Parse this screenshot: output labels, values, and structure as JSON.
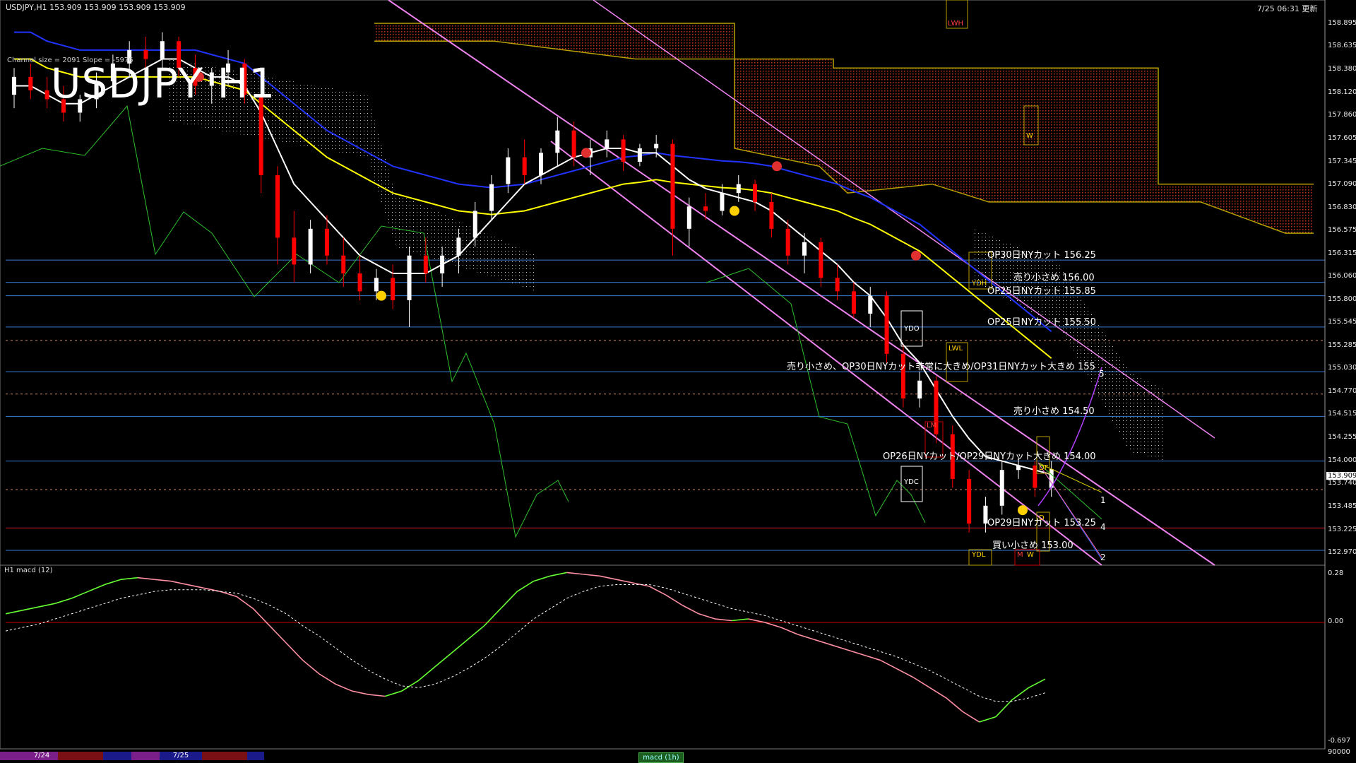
{
  "header": {
    "instrument_info": "USDJPY,H1  153.909 153.909 153.909 153.909",
    "timestamp": "7/25 06:31 更新"
  },
  "title": "USDJPY H1",
  "channel_info": "Channel size = 2091  Slope = -5976",
  "subwindow_title": "H1  macd (12)",
  "current_price": "153.909",
  "colors": {
    "background": "#000000",
    "bull_candle": "#ffffff",
    "bear_candle": "#ff0000",
    "channel": "#ee82ee",
    "ma_white": "#ffffff",
    "ma_yellow": "#ffff00",
    "ma_blue": "#2233ff",
    "cloud_red": "#c0361a",
    "level_line": "#3a7bd5",
    "macd_up": "#66ff33",
    "macd_down": "#ff8fa3",
    "macd_signal": "#ffffff"
  },
  "price_axis": [
    "158.895",
    "158.635",
    "158.380",
    "158.120",
    "157.860",
    "157.605",
    "157.345",
    "157.090",
    "156.830",
    "156.575",
    "156.315",
    "156.060",
    "155.800",
    "155.545",
    "155.285",
    "155.030",
    "154.770",
    "154.515",
    "154.255",
    "154.000",
    "153.740",
    "153.485",
    "153.225",
    "152.970"
  ],
  "macd_axis": [
    "0.28",
    "0.00",
    "-0.697",
    "90000"
  ],
  "level_labels": [
    {
      "text": "OP30日NYカット 156.25",
      "price": 156.25
    },
    {
      "text": "売り小さめ 156.00",
      "price": 156.0
    },
    {
      "text": "OP25日NYカット 155.85",
      "price": 155.85
    },
    {
      "text": "OP25日NYカット 155.50",
      "price": 155.5
    },
    {
      "text": "売り小さめ、OP30日NYカット非常に大きめ/OP31日NYカット大きめ 155",
      "price": 155.0
    },
    {
      "text": "売り小さめ 154.50",
      "price": 154.5
    },
    {
      "text": "OP26日NYカット/OP29日NYカット大きめ 154.00",
      "price": 154.0
    },
    {
      "text": "OP29日NYカット 153.25",
      "price": 153.25
    },
    {
      "text": "買い小さめ 153.00",
      "price": 153.0
    }
  ],
  "box_labels": {
    "lwh": "LWH",
    "w": "W",
    "ydh": "YDH",
    "ydo": "YDO",
    "lwl": "LWL",
    "lm": "LM",
    "ydc": "YDC",
    "df": "DF",
    "d": "D",
    "ydl": "YDL",
    "m": "M",
    "w2": "W"
  },
  "fan_labels": [
    "1",
    "4",
    "2",
    "5"
  ],
  "bottom_dates": [
    "7/24",
    "7/25"
  ],
  "bottom_tab": "macd (1h)",
  "chart_data": {
    "type": "candlestick",
    "title": "USDJPY H1",
    "y_range": [
      152.85,
      159.05
    ],
    "candles": [
      {
        "o": 158.1,
        "h": 158.4,
        "l": 157.95,
        "c": 158.3
      },
      {
        "o": 158.3,
        "h": 158.45,
        "l": 158.05,
        "c": 158.15
      },
      {
        "o": 158.15,
        "h": 158.3,
        "l": 157.95,
        "c": 158.05
      },
      {
        "o": 158.05,
        "h": 158.2,
        "l": 157.8,
        "c": 157.9
      },
      {
        "o": 157.9,
        "h": 158.1,
        "l": 157.8,
        "c": 158.05
      },
      {
        "o": 158.05,
        "h": 158.35,
        "l": 157.95,
        "c": 158.25
      },
      {
        "o": 158.25,
        "h": 158.55,
        "l": 158.15,
        "c": 158.45
      },
      {
        "o": 158.45,
        "h": 158.7,
        "l": 158.3,
        "c": 158.6
      },
      {
        "o": 158.6,
        "h": 158.75,
        "l": 158.4,
        "c": 158.5
      },
      {
        "o": 158.5,
        "h": 158.8,
        "l": 158.4,
        "c": 158.7
      },
      {
        "o": 158.7,
        "h": 158.75,
        "l": 158.3,
        "c": 158.4
      },
      {
        "o": 158.4,
        "h": 158.55,
        "l": 158.1,
        "c": 158.2
      },
      {
        "o": 158.2,
        "h": 158.4,
        "l": 158.0,
        "c": 158.35
      },
      {
        "o": 158.35,
        "h": 158.6,
        "l": 158.2,
        "c": 158.45
      },
      {
        "o": 158.45,
        "h": 158.5,
        "l": 158.0,
        "c": 158.1
      },
      {
        "o": 158.1,
        "h": 158.15,
        "l": 157.0,
        "c": 157.2
      },
      {
        "o": 157.2,
        "h": 157.3,
        "l": 156.2,
        "c": 156.5
      },
      {
        "o": 156.5,
        "h": 156.8,
        "l": 156.0,
        "c": 156.2
      },
      {
        "o": 156.2,
        "h": 156.7,
        "l": 156.1,
        "c": 156.6
      },
      {
        "o": 156.6,
        "h": 156.75,
        "l": 156.2,
        "c": 156.3
      },
      {
        "o": 156.3,
        "h": 156.5,
        "l": 155.95,
        "c": 156.1
      },
      {
        "o": 156.1,
        "h": 156.3,
        "l": 155.8,
        "c": 155.9
      },
      {
        "o": 155.9,
        "h": 156.15,
        "l": 155.8,
        "c": 156.05
      },
      {
        "o": 156.05,
        "h": 156.2,
        "l": 155.7,
        "c": 155.8
      },
      {
        "o": 155.8,
        "h": 156.4,
        "l": 155.5,
        "c": 156.3
      },
      {
        "o": 156.3,
        "h": 156.5,
        "l": 156.0,
        "c": 156.1
      },
      {
        "o": 156.1,
        "h": 156.4,
        "l": 155.95,
        "c": 156.3
      },
      {
        "o": 156.3,
        "h": 156.6,
        "l": 156.1,
        "c": 156.5
      },
      {
        "o": 156.5,
        "h": 156.9,
        "l": 156.4,
        "c": 156.8
      },
      {
        "o": 156.8,
        "h": 157.2,
        "l": 156.7,
        "c": 157.1
      },
      {
        "o": 157.1,
        "h": 157.5,
        "l": 157.0,
        "c": 157.4
      },
      {
        "o": 157.4,
        "h": 157.6,
        "l": 157.1,
        "c": 157.2
      },
      {
        "o": 157.2,
        "h": 157.5,
        "l": 157.1,
        "c": 157.45
      },
      {
        "o": 157.45,
        "h": 157.85,
        "l": 157.3,
        "c": 157.7
      },
      {
        "o": 157.7,
        "h": 157.8,
        "l": 157.3,
        "c": 157.4
      },
      {
        "o": 157.4,
        "h": 157.6,
        "l": 157.2,
        "c": 157.5
      },
      {
        "o": 157.5,
        "h": 157.7,
        "l": 157.4,
        "c": 157.6
      },
      {
        "o": 157.6,
        "h": 157.65,
        "l": 157.25,
        "c": 157.35
      },
      {
        "o": 157.35,
        "h": 157.55,
        "l": 157.3,
        "c": 157.5
      },
      {
        "o": 157.5,
        "h": 157.65,
        "l": 157.4,
        "c": 157.55
      },
      {
        "o": 157.55,
        "h": 157.6,
        "l": 156.3,
        "c": 156.6
      },
      {
        "o": 156.6,
        "h": 156.95,
        "l": 156.4,
        "c": 156.85
      },
      {
        "o": 156.85,
        "h": 157.0,
        "l": 156.7,
        "c": 156.8
      },
      {
        "o": 156.8,
        "h": 157.1,
        "l": 156.75,
        "c": 157.0
      },
      {
        "o": 157.0,
        "h": 157.2,
        "l": 156.9,
        "c": 157.1
      },
      {
        "o": 157.1,
        "h": 157.15,
        "l": 156.8,
        "c": 156.9
      },
      {
        "o": 156.9,
        "h": 157.0,
        "l": 156.5,
        "c": 156.6
      },
      {
        "o": 156.6,
        "h": 156.7,
        "l": 156.2,
        "c": 156.3
      },
      {
        "o": 156.3,
        "h": 156.55,
        "l": 156.1,
        "c": 156.45
      },
      {
        "o": 156.45,
        "h": 156.5,
        "l": 155.95,
        "c": 156.05
      },
      {
        "o": 156.05,
        "h": 156.2,
        "l": 155.8,
        "c": 155.9
      },
      {
        "o": 155.9,
        "h": 156.0,
        "l": 155.6,
        "c": 155.65
      },
      {
        "o": 155.65,
        "h": 155.95,
        "l": 155.5,
        "c": 155.85
      },
      {
        "o": 155.85,
        "h": 155.9,
        "l": 155.1,
        "c": 155.2
      },
      {
        "o": 155.2,
        "h": 155.3,
        "l": 154.6,
        "c": 154.7
      },
      {
        "o": 154.7,
        "h": 155.0,
        "l": 154.6,
        "c": 154.9
      },
      {
        "o": 154.9,
        "h": 154.95,
        "l": 154.2,
        "c": 154.3
      },
      {
        "o": 154.3,
        "h": 154.4,
        "l": 153.7,
        "c": 153.8
      },
      {
        "o": 153.8,
        "h": 153.9,
        "l": 153.2,
        "c": 153.3
      },
      {
        "o": 153.3,
        "h": 153.6,
        "l": 153.2,
        "c": 153.5
      },
      {
        "o": 153.5,
        "h": 154.0,
        "l": 153.4,
        "c": 153.9
      },
      {
        "o": 153.9,
        "h": 154.05,
        "l": 153.8,
        "c": 153.95
      },
      {
        "o": 153.95,
        "h": 154.0,
        "l": 153.6,
        "c": 153.7
      },
      {
        "o": 153.7,
        "h": 154.0,
        "l": 153.6,
        "c": 153.91
      }
    ],
    "ma_white": [
      158.2,
      158.2,
      158.1,
      158.0,
      158.0,
      158.1,
      158.2,
      158.3,
      158.4,
      158.5,
      158.5,
      158.4,
      158.3,
      158.3,
      158.2,
      157.9,
      157.5,
      157.1,
      156.9,
      156.7,
      156.5,
      156.3,
      156.2,
      156.1,
      156.1,
      156.1,
      156.2,
      156.3,
      156.5,
      156.7,
      156.9,
      157.1,
      157.2,
      157.3,
      157.4,
      157.45,
      157.5,
      157.5,
      157.45,
      157.45,
      157.3,
      157.15,
      157.05,
      157.0,
      156.95,
      156.9,
      156.8,
      156.65,
      156.5,
      156.35,
      156.2,
      156.0,
      155.85,
      155.6,
      155.3,
      155.1,
      154.8,
      154.5,
      154.25,
      154.05,
      154.0,
      153.95,
      153.9,
      153.85
    ],
    "ma_yellow": [
      158.5,
      158.5,
      158.4,
      158.35,
      158.3,
      158.3,
      158.3,
      158.3,
      158.3,
      158.3,
      158.3,
      158.3,
      158.25,
      158.2,
      158.15,
      158.0,
      157.85,
      157.7,
      157.55,
      157.4,
      157.3,
      157.2,
      157.1,
      157.0,
      156.95,
      156.9,
      156.85,
      156.8,
      156.78,
      156.76,
      156.78,
      156.8,
      156.85,
      156.9,
      156.95,
      157.0,
      157.05,
      157.1,
      157.12,
      157.15,
      157.12,
      157.1,
      157.08,
      157.06,
      157.05,
      157.03,
      157.0,
      156.95,
      156.9,
      156.85,
      156.8,
      156.72,
      156.65,
      156.55,
      156.45,
      156.35,
      156.2,
      156.05,
      155.9,
      155.75,
      155.6,
      155.45,
      155.3,
      155.15
    ],
    "macd": [
      0.05,
      0.07,
      0.09,
      0.11,
      0.14,
      0.18,
      0.22,
      0.25,
      0.26,
      0.25,
      0.24,
      0.22,
      0.2,
      0.18,
      0.15,
      0.08,
      -0.02,
      -0.12,
      -0.22,
      -0.3,
      -0.36,
      -0.4,
      -0.42,
      -0.43,
      -0.4,
      -0.34,
      -0.26,
      -0.18,
      -0.1,
      -0.02,
      0.08,
      0.18,
      0.24,
      0.27,
      0.29,
      0.28,
      0.27,
      0.25,
      0.23,
      0.21,
      0.16,
      0.1,
      0.05,
      0.02,
      0.01,
      0.02,
      0.0,
      -0.03,
      -0.07,
      -0.1,
      -0.13,
      -0.16,
      -0.19,
      -0.22,
      -0.27,
      -0.32,
      -0.38,
      -0.44,
      -0.52,
      -0.58,
      -0.55,
      -0.45,
      -0.38,
      -0.33
    ],
    "macd_signal": [
      -0.05,
      -0.03,
      -0.01,
      0.02,
      0.05,
      0.08,
      0.11,
      0.14,
      0.16,
      0.18,
      0.19,
      0.19,
      0.19,
      0.18,
      0.17,
      0.14,
      0.1,
      0.05,
      -0.02,
      -0.08,
      -0.15,
      -0.22,
      -0.28,
      -0.33,
      -0.37,
      -0.38,
      -0.36,
      -0.32,
      -0.27,
      -0.21,
      -0.14,
      -0.06,
      0.02,
      0.08,
      0.14,
      0.18,
      0.21,
      0.22,
      0.22,
      0.22,
      0.2,
      0.17,
      0.14,
      0.11,
      0.08,
      0.06,
      0.04,
      0.01,
      -0.02,
      -0.05,
      -0.08,
      -0.11,
      -0.14,
      -0.17,
      -0.2,
      -0.24,
      -0.28,
      -0.33,
      -0.38,
      -0.43,
      -0.46,
      -0.46,
      -0.44,
      -0.41
    ],
    "macd_range": [
      -0.72,
      0.3
    ]
  }
}
